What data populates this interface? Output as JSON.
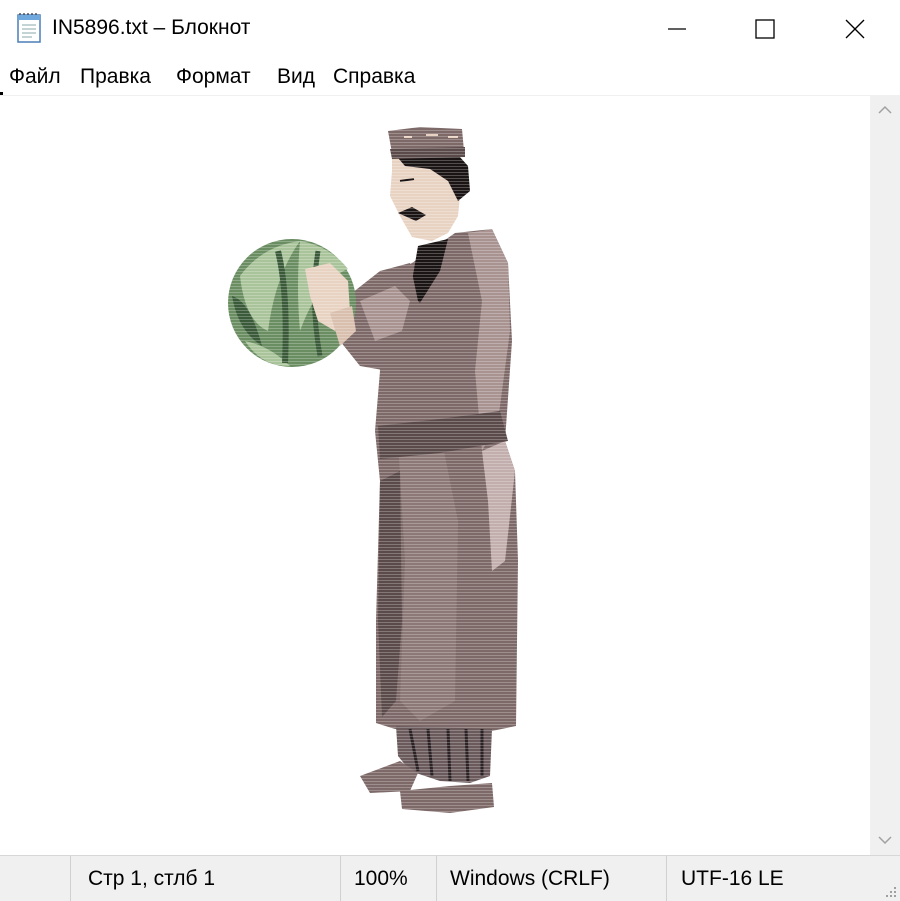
{
  "window": {
    "title": "IN5896.txt – Блокнот"
  },
  "menu": {
    "items": [
      "Файл",
      "Правка",
      "Формат",
      "Вид",
      "Справка"
    ]
  },
  "editor": {
    "content_icon": "man-holding-watermelon-ascii-art"
  },
  "statusbar": {
    "position": "Стр 1, стлб 1",
    "zoom": "100%",
    "line_endings": "Windows (CRLF)",
    "encoding": "UTF-16 LE"
  },
  "colors": {
    "robe": "#7d6a68",
    "robe_light": "#a89391",
    "robe_dark": "#5a4a49",
    "skin": "#e8d2c2",
    "hair": "#1a1414",
    "watermelon_green": "#6a8e62",
    "watermelon_light": "#a9c49a",
    "watermelon_dark": "#3b5a3a"
  }
}
